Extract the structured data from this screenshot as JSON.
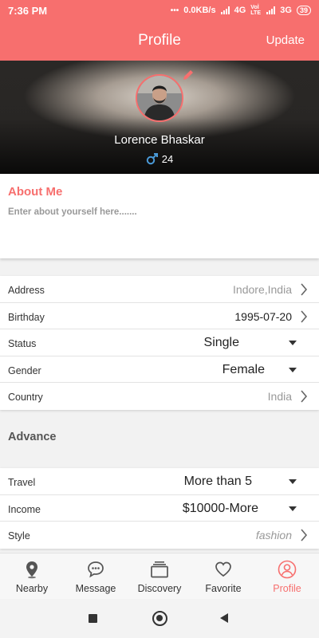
{
  "status_bar": {
    "time": "7:36 PM",
    "dots": "•••",
    "speed": "0.0KB/s",
    "network1": "4G",
    "volte": "Voİ LTE",
    "network2": "3G",
    "battery": "39"
  },
  "app_bar": {
    "title": "Profile",
    "update_label": "Update"
  },
  "profile": {
    "name": "Lorence Bhaskar",
    "gender_icon": "male-icon",
    "age": "24"
  },
  "about": {
    "heading": "About Me",
    "placeholder": "Enter about yourself here......."
  },
  "basic_info": [
    {
      "label": "Address",
      "value": "Indore,India",
      "control": "chevron"
    },
    {
      "label": "Birthday",
      "value": "1995-07-20",
      "control": "chevron"
    },
    {
      "label": "Status",
      "value": "Single",
      "control": "dropdown"
    },
    {
      "label": "Gender",
      "value": "Female",
      "control": "dropdown"
    },
    {
      "label": "Country",
      "value": "India",
      "control": "chevron"
    }
  ],
  "advance": {
    "title": "Advance",
    "rows": [
      {
        "label": "Travel",
        "value": "More than 5",
        "control": "dropdown"
      },
      {
        "label": "Income",
        "value": "$10000-More",
        "control": "dropdown"
      },
      {
        "label": "Style",
        "value": "fashion",
        "control": "chevron"
      }
    ]
  },
  "tabs": [
    {
      "label": "Nearby",
      "icon": "location-pin-icon"
    },
    {
      "label": "Message",
      "icon": "chat-bubble-icon"
    },
    {
      "label": "Discovery",
      "icon": "cards-stack-icon"
    },
    {
      "label": "Favorite",
      "icon": "heart-icon"
    },
    {
      "label": "Profile",
      "icon": "user-icon",
      "active": true
    }
  ],
  "colors": {
    "accent": "#f76f6e",
    "male_icon": "#4a9ad8"
  }
}
